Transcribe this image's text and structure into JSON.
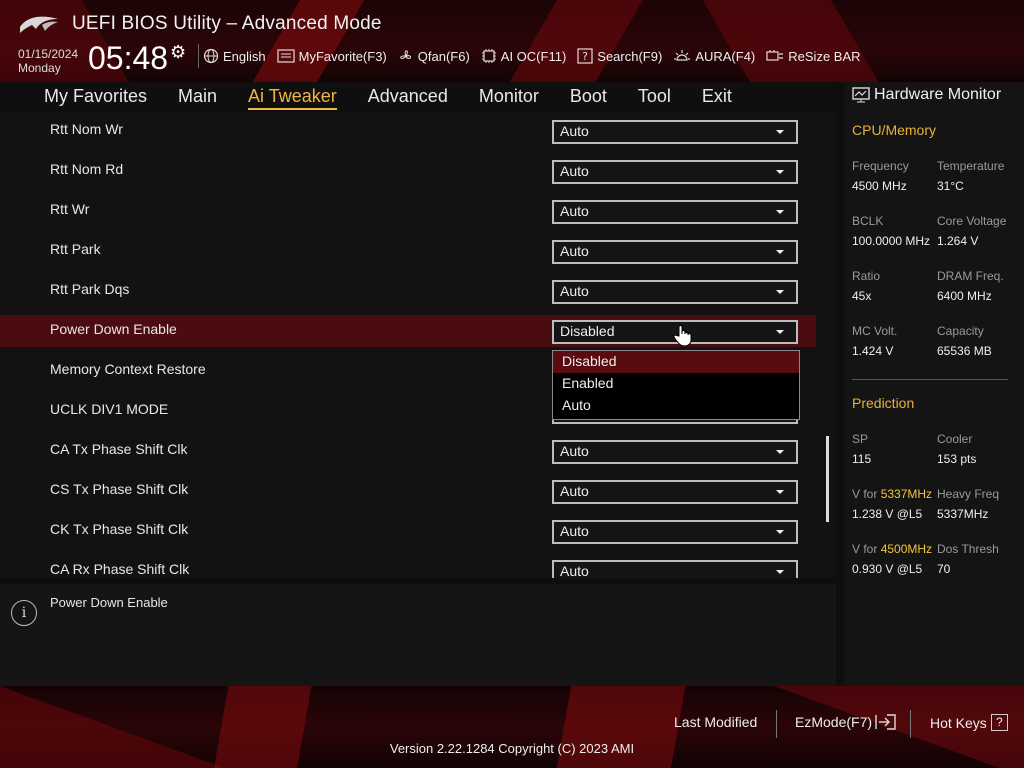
{
  "header": {
    "title": "UEFI BIOS Utility – Advanced Mode",
    "date": "01/15/2024",
    "weekday": "Monday",
    "time": "05:48"
  },
  "toolbar": {
    "items": [
      {
        "label": "English",
        "icon": "globe-icon"
      },
      {
        "label": "MyFavorite(F3)",
        "icon": "favorite-icon"
      },
      {
        "label": "Qfan(F6)",
        "icon": "fan-icon"
      },
      {
        "label": "AI OC(F11)",
        "icon": "chip-icon"
      },
      {
        "label": "Search(F9)",
        "icon": "search-icon"
      },
      {
        "label": "AURA(F4)",
        "icon": "aura-icon"
      },
      {
        "label": "ReSize BAR",
        "icon": "resize-bar-icon"
      }
    ]
  },
  "nav": {
    "tabs": [
      {
        "label": "My Favorites"
      },
      {
        "label": "Main"
      },
      {
        "label": "Ai Tweaker",
        "active": true
      },
      {
        "label": "Advanced"
      },
      {
        "label": "Monitor"
      },
      {
        "label": "Boot"
      },
      {
        "label": "Tool"
      },
      {
        "label": "Exit"
      }
    ]
  },
  "settings": [
    {
      "label": "Rtt Nom Wr",
      "value": "Auto"
    },
    {
      "label": "Rtt Nom Rd",
      "value": "Auto"
    },
    {
      "label": "Rtt Wr",
      "value": "Auto"
    },
    {
      "label": "Rtt Park",
      "value": "Auto"
    },
    {
      "label": "Rtt Park Dqs",
      "value": "Auto"
    },
    {
      "label": "Power Down Enable",
      "value": "Disabled"
    },
    {
      "label": "Memory Context Restore",
      "value": ""
    },
    {
      "label": "UCLK DIV1 MODE",
      "value": ""
    },
    {
      "label": "CA Tx Phase Shift Clk",
      "value": "Auto"
    },
    {
      "label": "CS Tx Phase Shift Clk",
      "value": "Auto"
    },
    {
      "label": "CK Tx Phase Shift Clk",
      "value": "Auto"
    },
    {
      "label": "CA Rx Phase Shift Clk",
      "value": "Auto"
    }
  ],
  "dropdown": {
    "options": [
      "Disabled",
      "Enabled",
      "Auto"
    ],
    "highlighted": "Disabled"
  },
  "help": {
    "text": "Power Down Enable"
  },
  "hardware_monitor": {
    "title": "Hardware Monitor",
    "cpu_section": "CPU/Memory",
    "frequency_label": "Frequency",
    "frequency": "4500 MHz",
    "temperature_label": "Temperature",
    "temperature": "31°C",
    "bclk_label": "BCLK",
    "bclk": "100.0000 MHz",
    "core_voltage_label": "Core Voltage",
    "core_voltage": "1.264 V",
    "ratio_label": "Ratio",
    "ratio": "45x",
    "dram_freq_label": "DRAM Freq.",
    "dram_freq": "6400 MHz",
    "mc_volt_label": "MC Volt.",
    "mc_volt": "1.424 V",
    "capacity_label": "Capacity",
    "capacity": "65536 MB",
    "prediction_section": "Prediction",
    "sp_label": "SP",
    "sp": "115",
    "cooler_label": "Cooler",
    "cooler": "153 pts",
    "v_for_prefix": "V for",
    "v_for_1_freq": "5337MHz",
    "v_for_1": "1.238 V @L5",
    "heavy_freq_label": "Heavy Freq",
    "heavy_freq": "5337MHz",
    "v_for_2_freq": "4500MHz",
    "v_for_2": "0.930 V @L5",
    "dos_thresh_label": "Dos Thresh",
    "dos_thresh": "70"
  },
  "footer": {
    "last_modified": "Last Modified",
    "ezmode": "EzMode(F7)",
    "hot_keys": "Hot Keys",
    "hot_keys_key": "?",
    "version": "Version 2.22.1284 Copyright (C) 2023 AMI"
  }
}
